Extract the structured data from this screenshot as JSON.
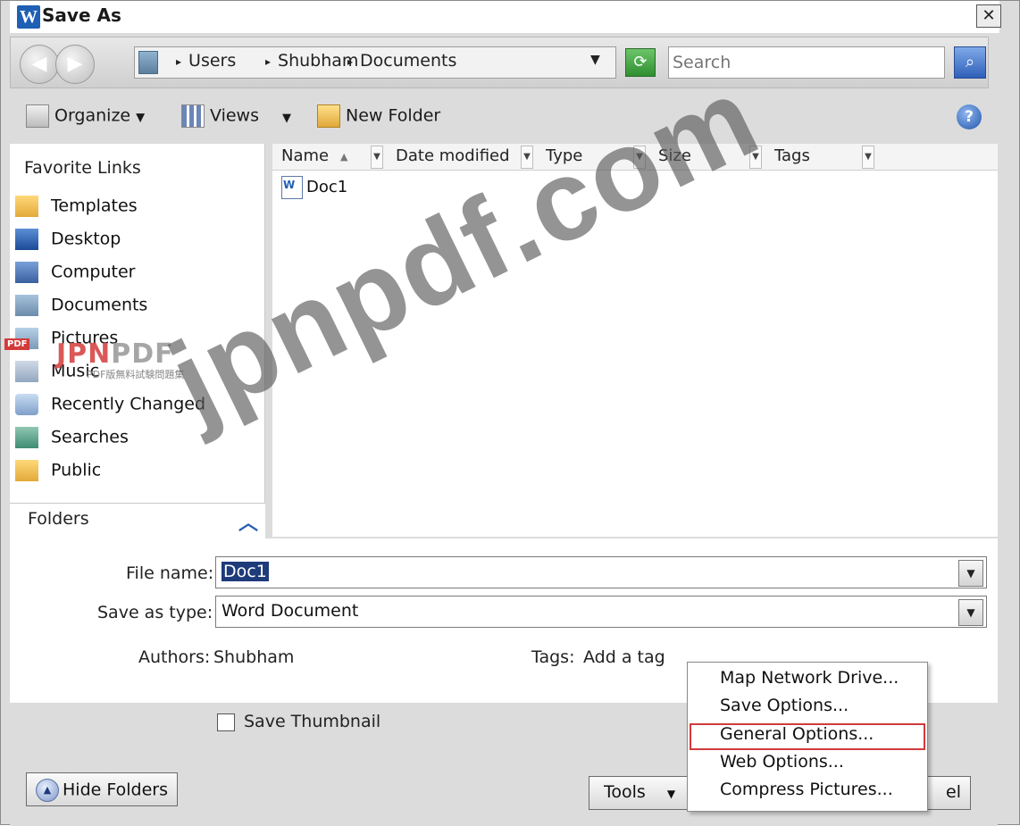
{
  "window": {
    "title": "Save As",
    "close_glyph": "✕"
  },
  "address": {
    "breadcrumbs": [
      "Users",
      "Shubham",
      "Documents"
    ],
    "search_placeholder": "Search"
  },
  "toolbar": {
    "organize": "Organize",
    "views": "Views",
    "new_folder": "New Folder",
    "help": "?"
  },
  "favorite_links": {
    "title": "Favorite Links",
    "items": [
      {
        "label": "Templates",
        "icon": "folder-icon"
      },
      {
        "label": "Desktop",
        "icon": "desktop-icon"
      },
      {
        "label": "Computer",
        "icon": "computer-icon"
      },
      {
        "label": "Documents",
        "icon": "documents-icon"
      },
      {
        "label": "Pictures",
        "icon": "pictures-icon"
      },
      {
        "label": "Music",
        "icon": "music-icon"
      },
      {
        "label": "Recently Changed",
        "icon": "recent-icon"
      },
      {
        "label": "Searches",
        "icon": "searches-icon"
      },
      {
        "label": "Public",
        "icon": "folder-icon"
      }
    ]
  },
  "folders": {
    "label": "Folders"
  },
  "columns": [
    "Name",
    "Date modified",
    "Type",
    "Size",
    "Tags"
  ],
  "files": [
    {
      "name": "Doc1"
    }
  ],
  "form": {
    "file_name_label": "File name:",
    "file_name_value": "Doc1",
    "save_type_label": "Save as type:",
    "save_type_value": "Word Document",
    "authors_label": "Authors:",
    "authors_value": "Shubham",
    "tags_label": "Tags:",
    "tags_value": "Add a tag"
  },
  "footer": {
    "save_thumbnail": "Save Thumbnail",
    "hide_folders": "Hide Folders",
    "tools": "Tools",
    "cancel_partial": "el"
  },
  "tools_menu": {
    "items": [
      "Map Network Drive...",
      "Save Options...",
      "General Options...",
      "Web Options...",
      "Compress Pictures..."
    ],
    "highlighted": "General Options..."
  },
  "watermark": {
    "big": "jpnpdf.com",
    "logo_tag": "PDF",
    "logo_brand_a": "JPN",
    "logo_brand_b": "PDF",
    "logo_tagline": "PDF版無料試験問題集"
  },
  "colors": {
    "title_bar": "#ffffff",
    "selection": "#1e3b7a",
    "menu_highlight_border": "#d23a3a"
  }
}
